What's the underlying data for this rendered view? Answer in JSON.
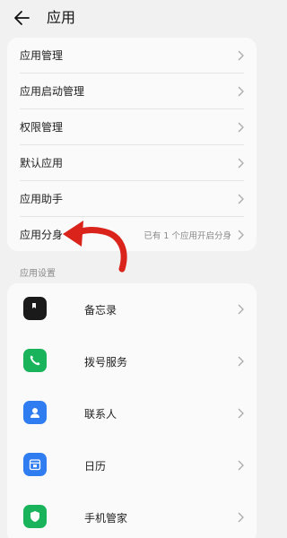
{
  "header": {
    "title": "应用"
  },
  "menu": [
    {
      "label": "应用管理"
    },
    {
      "label": "应用启动管理"
    },
    {
      "label": "权限管理"
    },
    {
      "label": "默认应用"
    },
    {
      "label": "应用助手"
    },
    {
      "label": "应用分身",
      "sub": "已有 1 个应用开启分身"
    }
  ],
  "section": {
    "label": "应用设置"
  },
  "apps": [
    {
      "label": "备忘录",
      "icon": "notes-icon",
      "color": "#1a1a1a"
    },
    {
      "label": "拨号服务",
      "icon": "phone-icon",
      "color": "#19b35c"
    },
    {
      "label": "联系人",
      "icon": "contacts-icon",
      "color": "#2f7df0"
    },
    {
      "label": "日历",
      "icon": "calendar-icon",
      "color": "#2f7df0"
    },
    {
      "label": "手机管家",
      "icon": "shield-icon",
      "color": "#19b35c"
    }
  ],
  "colors": {
    "annotation_arrow": "#d9231b"
  }
}
